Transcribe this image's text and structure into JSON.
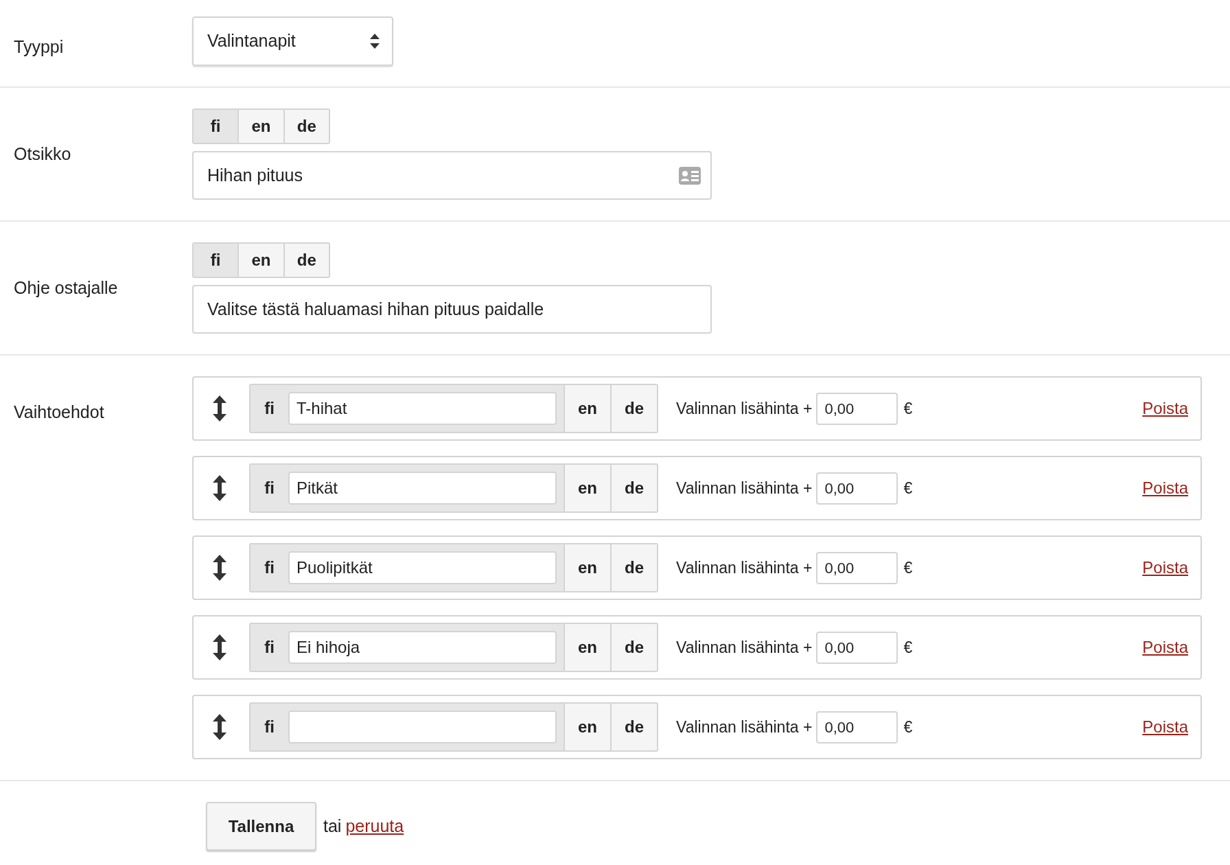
{
  "type_field": {
    "label": "Tyyppi",
    "value": "Valintanapit"
  },
  "title_field": {
    "label": "Otsikko",
    "languages": [
      {
        "label": "fi",
        "selected": true
      },
      {
        "label": "en",
        "selected": false
      },
      {
        "label": "de",
        "selected": false
      }
    ],
    "value": "Hihan pituus"
  },
  "instructions_field": {
    "label": "Ohje ostajalle",
    "languages": [
      {
        "label": "fi",
        "selected": true
      },
      {
        "label": "en",
        "selected": false
      },
      {
        "label": "de",
        "selected": false
      }
    ],
    "value": "Valitse tästä haluamasi hihan pituus paidalle"
  },
  "options": {
    "label": "Vaihtoehdot",
    "items": [
      {
        "languages": [
          {
            "label": "fi",
            "selected": true
          },
          {
            "label": "en",
            "selected": false
          },
          {
            "label": "de",
            "selected": false
          }
        ],
        "value": "T-hihat",
        "price_label": "Valinnan lisähinta +",
        "price": "0,00",
        "currency": "€",
        "remove": "Poista"
      },
      {
        "languages": [
          {
            "label": "fi",
            "selected": true
          },
          {
            "label": "en",
            "selected": false
          },
          {
            "label": "de",
            "selected": false
          }
        ],
        "value": "Pitkät",
        "price_label": "Valinnan lisähinta +",
        "price": "0,00",
        "currency": "€",
        "remove": "Poista"
      },
      {
        "languages": [
          {
            "label": "fi",
            "selected": true
          },
          {
            "label": "en",
            "selected": false
          },
          {
            "label": "de",
            "selected": false
          }
        ],
        "value": "Puolipitkät",
        "price_label": "Valinnan lisähinta +",
        "price": "0,00",
        "currency": "€",
        "remove": "Poista"
      },
      {
        "languages": [
          {
            "label": "fi",
            "selected": true
          },
          {
            "label": "en",
            "selected": false
          },
          {
            "label": "de",
            "selected": false
          }
        ],
        "value": "Ei hihoja",
        "price_label": "Valinnan lisähinta +",
        "price": "0,00",
        "currency": "€",
        "remove": "Poista"
      },
      {
        "languages": [
          {
            "label": "fi",
            "selected": true
          },
          {
            "label": "en",
            "selected": false
          },
          {
            "label": "de",
            "selected": false
          }
        ],
        "price_label": "Valinnan lisähinta +",
        "price": "0,00",
        "currency": "€",
        "remove": "Poista"
      }
    ]
  },
  "actions": {
    "save": "Tallenna",
    "separator": "tai",
    "cancel": "peruuta"
  }
}
